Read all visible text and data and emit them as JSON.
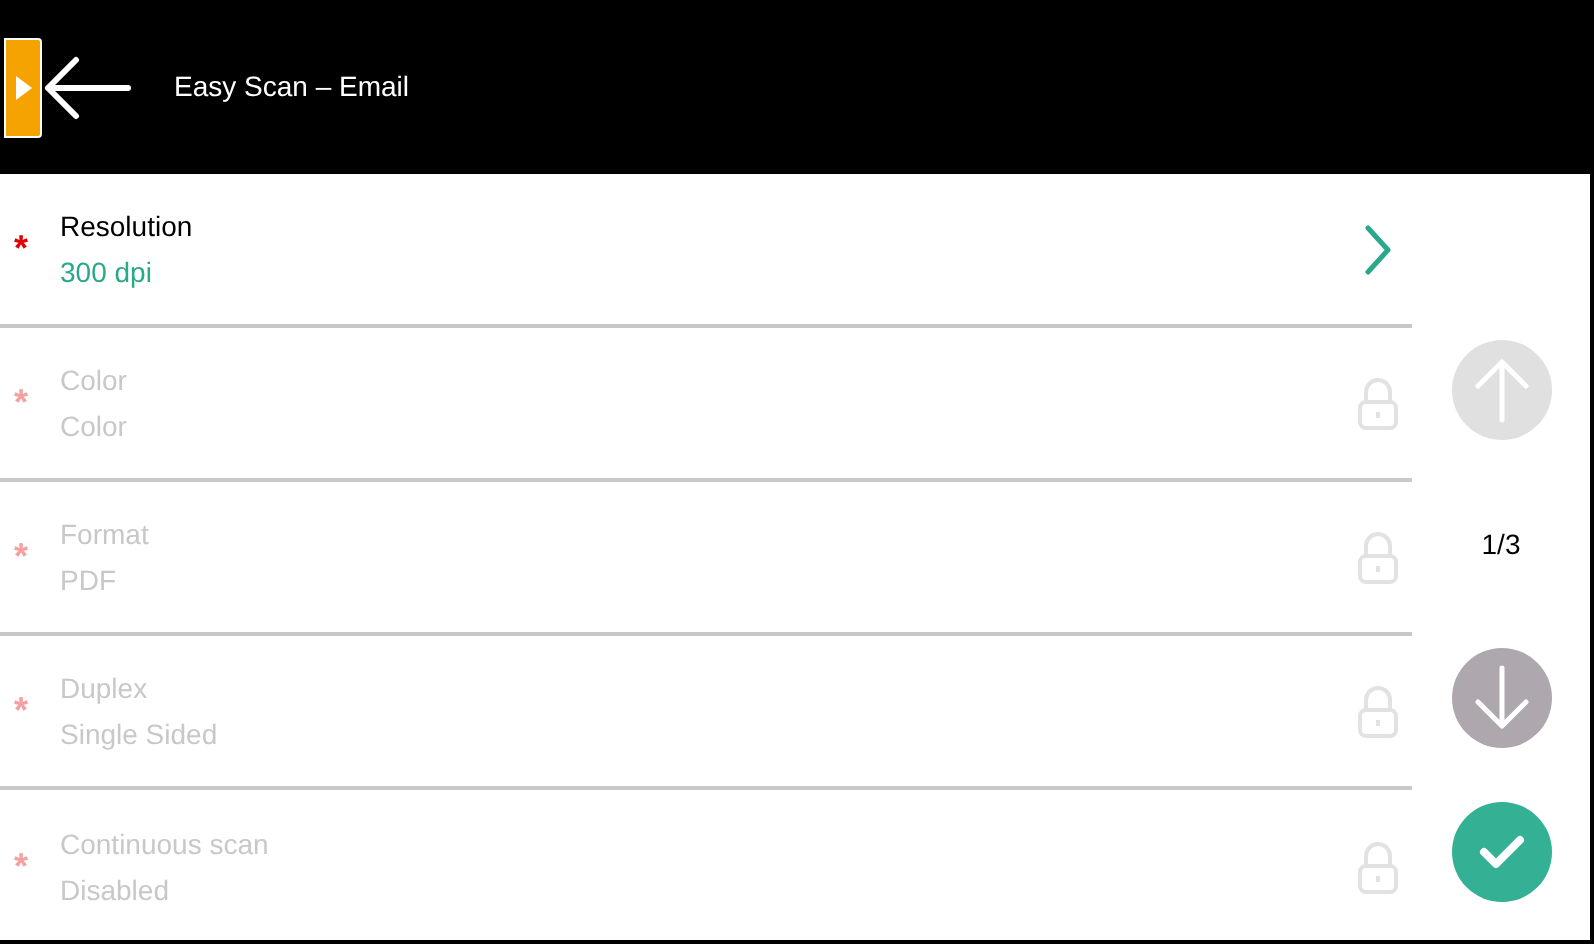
{
  "header": {
    "title": "Easy Scan – Email"
  },
  "settings": [
    {
      "marker": "*",
      "label": "Resolution",
      "value": "300 dpi",
      "locked": false
    },
    {
      "marker": "*",
      "label": "Color",
      "value": "Color",
      "locked": true
    },
    {
      "marker": "*",
      "label": "Format",
      "value": "PDF",
      "locked": true
    },
    {
      "marker": "*",
      "label": "Duplex",
      "value": "Single Sided",
      "locked": true
    },
    {
      "marker": "*",
      "label": "Continuous scan",
      "value": "Disabled",
      "locked": true
    }
  ],
  "pager": {
    "up_disabled": true,
    "page": "1/3",
    "down_disabled": false
  }
}
